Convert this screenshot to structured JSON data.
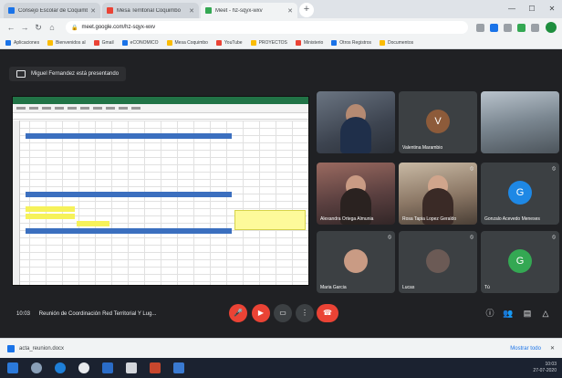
{
  "browser": {
    "tabs": [
      {
        "label": "Consejo Escolar de Coquimbo",
        "active": false
      },
      {
        "label": "Mesa Territorial Coquimbo",
        "active": false
      },
      {
        "label": "Meet - hz-sqyx-wxv",
        "active": true
      }
    ],
    "new_tab": "+",
    "url": "meet.google.com/hz-sqyx-wxv",
    "bookmarks": [
      "Aplicaciones",
      "Bienvenidos al",
      "Gmail",
      "eCONOMICO",
      "Mesa Coquimbo",
      "YouTube",
      "PROYECTOS",
      "Ministerio",
      "Otros Registros",
      "Documentos"
    ]
  },
  "meet": {
    "presenting_label": "Miguel Fernandez está presentando",
    "time": "10:03",
    "meeting_title": "Reunión de Coordinación Red Territorial Y Lug...",
    "participants": [
      {
        "name": "",
        "kind": "camera",
        "style": "cam"
      },
      {
        "name": "Valentina Marambio",
        "kind": "initial",
        "initial": "V",
        "color": "#8d5b3a"
      },
      {
        "name": "",
        "kind": "camera",
        "style": "cam3"
      },
      {
        "name": "Alexandra Ortega Almunia",
        "kind": "camera",
        "style": "cam2"
      },
      {
        "name": "Rosa Tapia Lopez Geraldo",
        "kind": "camera",
        "style": "cam4"
      },
      {
        "name": "Gonzalo Acevedo Meneses",
        "kind": "initial",
        "initial": "G",
        "color": "#1e88e5"
      },
      {
        "name": "Maria Garcia",
        "kind": "small-camera",
        "style": "cam4"
      },
      {
        "name": "Lucas",
        "kind": "small-camera",
        "style": "cam"
      },
      {
        "name": "Tú",
        "kind": "initial",
        "initial": "G",
        "color": "#34a853"
      }
    ]
  },
  "download": {
    "file": "acta_reunion.docx",
    "show_all": "Mostrar todo"
  },
  "taskbar": {
    "time": "10:03",
    "date": "27-07-2020"
  }
}
